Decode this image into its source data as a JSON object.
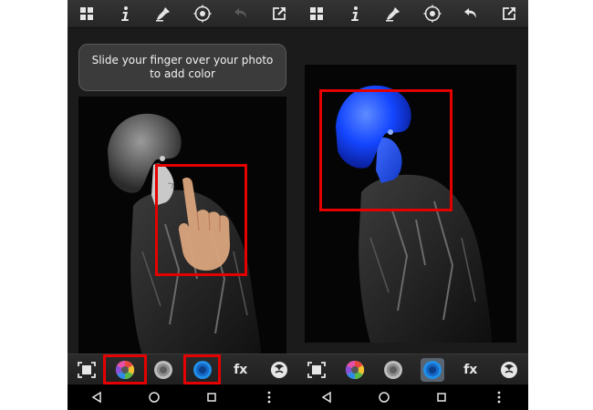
{
  "left_screen": {
    "hint_text": "Slide your finger over your photo to add color",
    "toolbar": {
      "fx_label": "fx"
    }
  },
  "right_screen": {
    "toolbar": {
      "fx_label": "fx"
    }
  },
  "icons": {
    "top_bar": [
      "grid-icon",
      "info-icon",
      "brush-icon",
      "target-icon",
      "undo-icon",
      "share-icon"
    ],
    "bottom_toolbar": [
      "fit-screen-icon",
      "color-wheel-icon",
      "gray-wheel-icon",
      "blue-wheel-icon",
      "fx-icon",
      "hair-icon"
    ],
    "nav_bar": [
      "back-icon",
      "home-icon",
      "recents-icon",
      "more-icon"
    ]
  },
  "colors": {
    "highlight_box": "#e50000",
    "colorized_tone": "#1446ff",
    "active_tool_bg": "#5a6470"
  }
}
